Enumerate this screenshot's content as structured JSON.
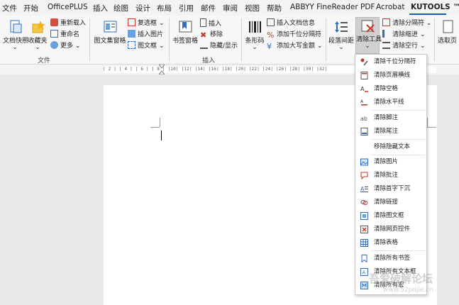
{
  "tabs": [
    "文件",
    "开始",
    "OfficePLUS",
    "插入",
    "绘图",
    "设计",
    "布局",
    "引用",
    "邮件",
    "审阅",
    "视图",
    "帮助",
    "ABBYY FineReader PDF",
    "Acrobat",
    "KUTOOLS ™"
  ],
  "ribbon": {
    "doc_snapshot": "文档快照",
    "favorites": "收藏夹",
    "reload": "重新载入",
    "rename": "重命名",
    "more": "更多",
    "group_file": "文件",
    "image_table_pane": "图文集窗格",
    "checkbox": "复选框",
    "insert_picture": "插入图片",
    "picture_frame": "图文框",
    "bookmark_pane": "书签窗格",
    "insert": "插入",
    "remove": "移除",
    "hide_show": "隐藏/显示",
    "barcode": "条形码",
    "insert_doc_info": "插入文档信息",
    "add_thousand_sep": "添加千位分隔符",
    "add_capital_amount": "添加大写金额",
    "group_insert": "插入",
    "para_spacing": "段落间距",
    "clear_tools": "清除工具",
    "clear_separator": "清除分隔符",
    "clear_indent": "清除缩进",
    "clear_empty_rows": "清除空行",
    "select_page": "选取页"
  },
  "ruler_text": "| 2 |  | 4 |  | 6 |  | 8 |  |10|  |12|  |14|  |16|  |18|  |20|  |22|  |24|  |26|  |28|  |30|  |32|",
  "dropdown_items": [
    {
      "label": "清除千位分隔符",
      "icon": "thousand-separator-icon",
      "color": "#c0392b"
    },
    {
      "label": "清除页眉横线",
      "icon": "header-line-icon",
      "color": "#c0392b"
    },
    {
      "label": "清除空格",
      "icon": "space-icon",
      "color": "#333333"
    },
    {
      "label": "清除水平线",
      "icon": "horizontal-line-icon",
      "color": "#c0392b"
    },
    {
      "label": "清除脚注",
      "icon": "footnote-icon",
      "color": "#555555"
    },
    {
      "label": "清除尾注",
      "icon": "endnote-icon",
      "color": "#2e6dc0"
    },
    {
      "label": "移除隐藏文本",
      "icon": "",
      "color": ""
    },
    {
      "label": "清除图片",
      "icon": "picture-icon",
      "color": "#2e6dc0"
    },
    {
      "label": "清除批注",
      "icon": "comment-icon",
      "color": "#c0392b"
    },
    {
      "label": "清除首字下沉",
      "icon": "drop-cap-icon",
      "color": "#2e6dc0"
    },
    {
      "label": "清除链接",
      "icon": "link-icon",
      "color": "#c0392b"
    },
    {
      "label": "清除图文框",
      "icon": "frame-icon",
      "color": "#2e6dc0"
    },
    {
      "label": "清除网页控件",
      "icon": "web-control-icon",
      "color": "#c0392b"
    },
    {
      "label": "清除表格",
      "icon": "table-icon",
      "color": "#2e6dc0"
    },
    {
      "label": "清除所有书签",
      "icon": "bookmark-icon",
      "color": "#2e6dc0"
    },
    {
      "label": "清除所有文本框",
      "icon": "textbox-icon",
      "color": "#2e6dc0"
    },
    {
      "label": "清除所有宏",
      "icon": "macro-icon",
      "color": "#2e6dc0"
    }
  ],
  "watermark": "吾爱破解论坛",
  "watermark_url": "www.52pojie.cn",
  "colors": {
    "accent": "#185abd",
    "ribbon_bg": "#f7f7f7",
    "page_bg": "#ffffff",
    "workspace_bg": "#e9e9e9"
  }
}
